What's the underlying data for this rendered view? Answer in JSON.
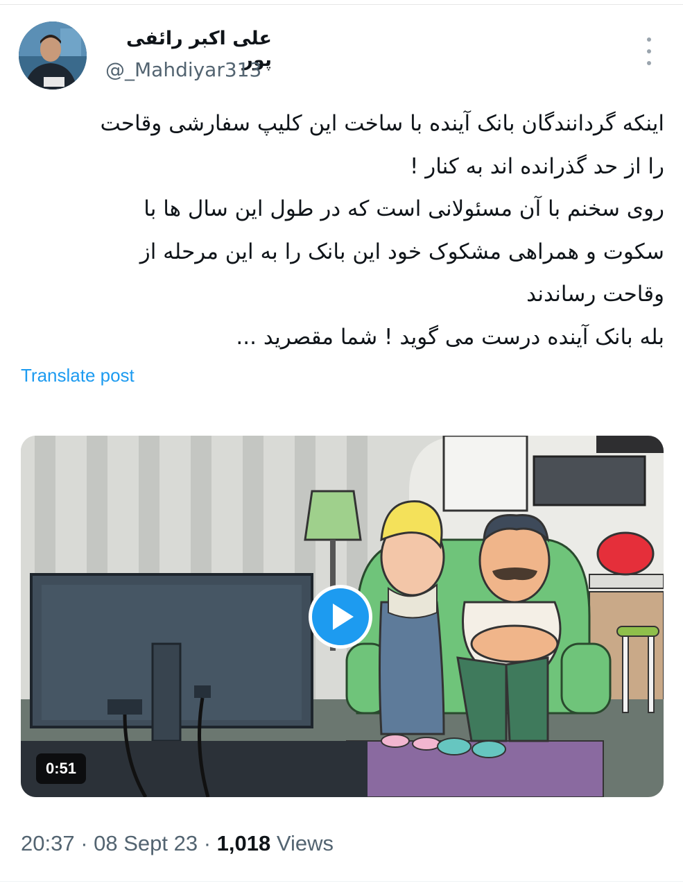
{
  "post": {
    "author_name": "علی اکبر رائفی پور",
    "author_handle": "@_Mahdiyar313",
    "text_lines": [
      "اینکه گردانندگان بانک آینده با ساخت این کلیپ سفارشی وقاحت",
      "را از حد گذرانده اند به کنار !",
      "روی سخنم با آن مسئولانی است که در طول این سال ها با",
      "سکوت و همراهی مشکوک خود این بانک را به این مرحله از",
      "وقاحت رساندند",
      "بله بانک آینده درست می گوید ! شما مقصرید ..."
    ],
    "translate_label": "Translate post",
    "video": {
      "duration": "0:51",
      "play_icon": "play-icon"
    },
    "meta": {
      "time": "20:37",
      "separator": " · ",
      "date": "08 Sept 23",
      "views_count": "1,018",
      "views_label": " Views"
    }
  },
  "colors": {
    "accent": "#1d9bf0",
    "secondary_text": "#536471",
    "primary_text": "#0f1419"
  }
}
